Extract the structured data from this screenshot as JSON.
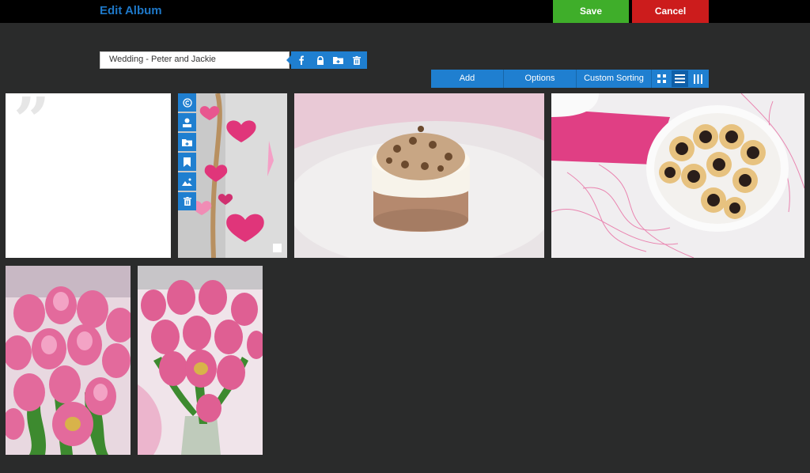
{
  "header": {
    "title": "Edit Album",
    "save_label": "Save",
    "cancel_label": "Cancel"
  },
  "album": {
    "name": "Wedding - Peter and Jackie"
  },
  "name_tools": [
    "facebook-icon",
    "lock-icon",
    "folder-icon",
    "trash-icon"
  ],
  "toolbar": {
    "add_label": "Add",
    "options_label": "Options",
    "sorting_label": "Custom Sorting",
    "views": [
      "grid-view-icon",
      "list-view-icon",
      "column-view-icon"
    ],
    "active_view": "list-view-icon"
  },
  "tile_tools": [
    "copyright-icon",
    "user-icon",
    "folder-icon",
    "bookmark-icon",
    "landscape-icon",
    "trash-icon"
  ],
  "photos": [
    {
      "subject": "text block with quote mark"
    },
    {
      "subject": "paper hearts garland"
    },
    {
      "subject": "chocolate mousse cake"
    },
    {
      "subject": "pastries on plate with pink napkin"
    },
    {
      "subject": "pink tulips bouquet"
    },
    {
      "subject": "pink tulips bouquet in vase"
    }
  ],
  "colors": {
    "accent": "#1f7fd0",
    "save": "#3fae2a",
    "cancel": "#cc1c1c",
    "background": "#2a2b2b",
    "title": "#1e78c8"
  }
}
